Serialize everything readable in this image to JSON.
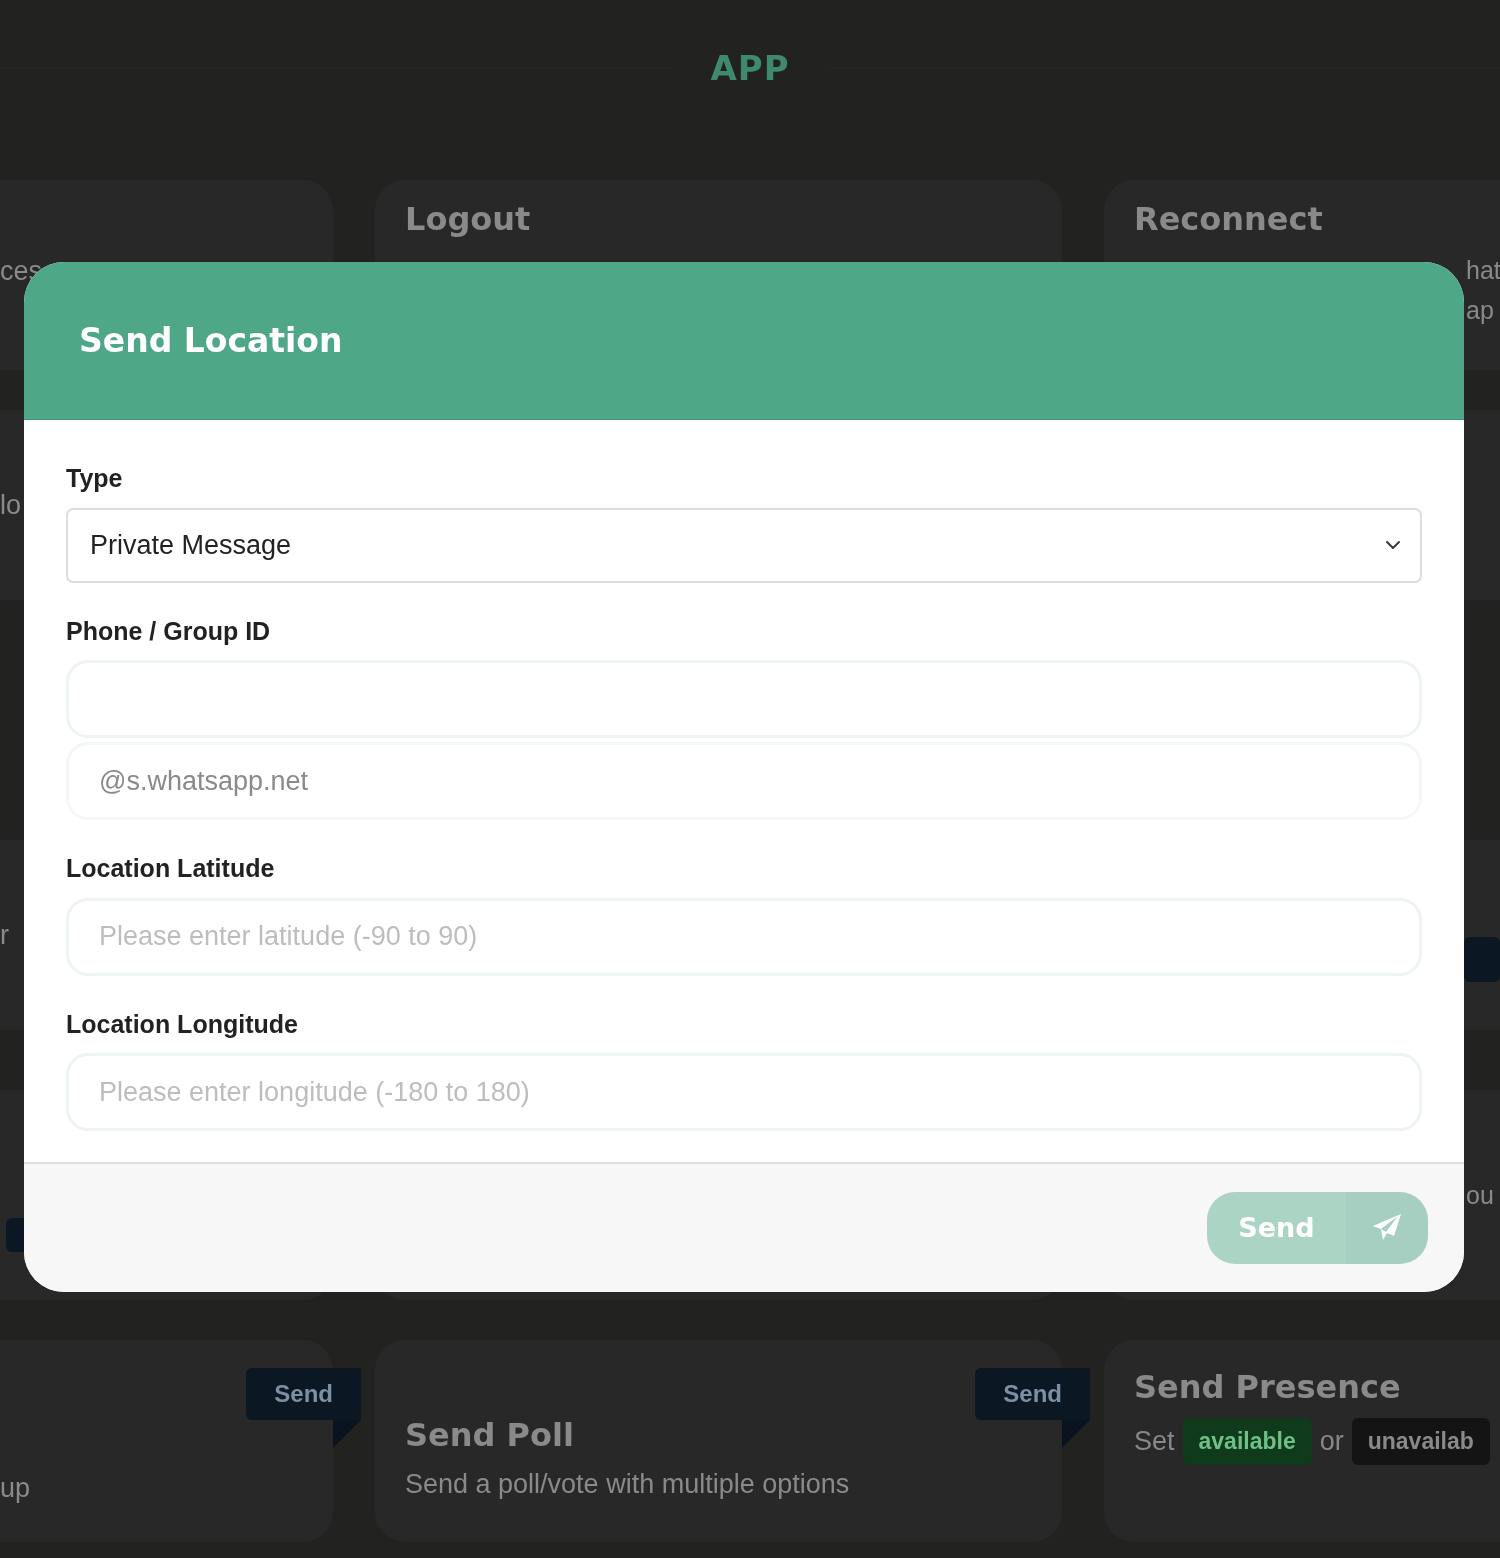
{
  "page": {
    "title": "APP"
  },
  "background_rows": [
    {
      "left": {
        "fragments": [
          "ces"
        ]
      },
      "middle": {
        "title": "Logout"
      },
      "right": {
        "title": "Reconnect",
        "fragments": [
          "hat",
          "ap"
        ]
      }
    },
    {
      "left": {
        "fragments": [
          "lo"
        ]
      }
    },
    {
      "left": {
        "fragments": [
          "r"
        ]
      },
      "right": {
        "button": true
      }
    },
    {
      "left": {
        "button": true
      },
      "right": {
        "fragments": [
          "ou"
        ]
      }
    },
    {
      "left": {
        "ribbon": "Send",
        "fragments": [
          "up"
        ]
      },
      "middle": {
        "ribbon": "Send",
        "title": "Send Poll",
        "description": "Send a poll/vote with multiple options"
      },
      "right": {
        "title": "Send Presence",
        "parts": [
          {
            "kind": "text",
            "text": "Set"
          },
          {
            "kind": "badge",
            "text": "available",
            "color": "#0f3a1c"
          },
          {
            "kind": "text",
            "text": "or"
          },
          {
            "kind": "badge",
            "text": "unavailab",
            "color": "#141414"
          }
        ]
      }
    }
  ],
  "modal": {
    "title": "Send Location",
    "fields": [
      {
        "kind": "select",
        "label": "Type",
        "value": "Private Message"
      },
      {
        "kind": "text",
        "label": "Phone / Group ID",
        "suffix": "@s.whatsapp.net"
      },
      {
        "kind": "text",
        "label": "Location Latitude",
        "placeholder": "Please enter latitude (-90 to 90)"
      },
      {
        "kind": "text",
        "label": "Location Longitude",
        "placeholder": "Please enter longitude (-180 to 180)"
      }
    ],
    "submit": {
      "label": "Send",
      "disabled": true
    }
  }
}
